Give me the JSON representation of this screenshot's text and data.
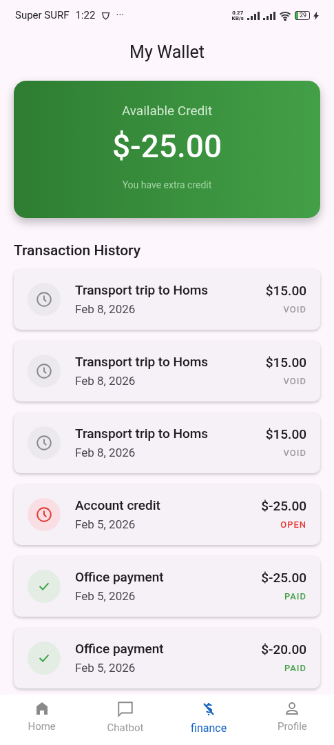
{
  "status_bar": {
    "carrier": "Super SURF",
    "time": "1:22",
    "more": "···",
    "speed_value": "0.27",
    "speed_unit": "KB/s",
    "battery": "29"
  },
  "title": "My Wallet",
  "credit_card": {
    "label": "Available Credit",
    "amount": "$-25.00",
    "note": "You have extra credit"
  },
  "history": {
    "heading": "Transaction History",
    "items": [
      {
        "title": "Transport trip to Homs",
        "date": "Feb 8, 2026",
        "amount": "$15.00",
        "status": "VOID",
        "kind": "void"
      },
      {
        "title": "Transport trip to Homs",
        "date": "Feb 8, 2026",
        "amount": "$15.00",
        "status": "VOID",
        "kind": "void"
      },
      {
        "title": "Transport trip to Homs",
        "date": "Feb 8, 2026",
        "amount": "$15.00",
        "status": "VOID",
        "kind": "void"
      },
      {
        "title": "Account credit",
        "date": "Feb 5, 2026",
        "amount": "$-25.00",
        "status": "OPEN",
        "kind": "open"
      },
      {
        "title": "Office payment",
        "date": "Feb 5, 2026",
        "amount": "$-25.00",
        "status": "PAID",
        "kind": "paid"
      },
      {
        "title": "Office payment",
        "date": "Feb 5, 2026",
        "amount": "$-20.00",
        "status": "PAID",
        "kind": "paid"
      }
    ]
  },
  "nav": [
    {
      "label": "Home",
      "kind": "home",
      "selected": false
    },
    {
      "label": "Chatbot",
      "kind": "chat",
      "selected": false
    },
    {
      "label": "finance",
      "kind": "money",
      "selected": true
    },
    {
      "label": "Profile",
      "kind": "person",
      "selected": false
    }
  ]
}
